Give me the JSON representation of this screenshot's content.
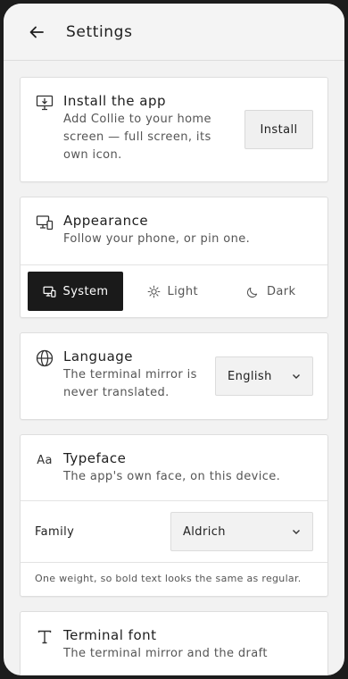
{
  "header": {
    "title": "Settings"
  },
  "install": {
    "title": "Install the app",
    "description": "Add Collie to your home screen — full screen, its own icon.",
    "button_label": "Install"
  },
  "appearance": {
    "title": "Appearance",
    "description": "Follow your phone, or pin one.",
    "options": [
      "System",
      "Light",
      "Dark"
    ],
    "selected": "System"
  },
  "language": {
    "title": "Language",
    "description": "The terminal mirror is never translated.",
    "value": "English"
  },
  "typeface": {
    "title": "Typeface",
    "description": "The app's own face, on this device.",
    "family_label": "Family",
    "family_value": "Aldrich",
    "note": "One weight, so bold text looks the same as regular."
  },
  "terminal_font": {
    "title": "Terminal font",
    "description": "The terminal mirror and the draft"
  },
  "icons": [
    "back-arrow-icon",
    "install-monitor-icon",
    "appearance-devices-icon",
    "globe-icon",
    "typeface-icon",
    "text-t-icon",
    "chevron-down-icon",
    "sun-icon",
    "moon-icon"
  ],
  "colors": {
    "accent": "#1a1a1a",
    "background": "#f2f2f2",
    "card": "#ffffff"
  }
}
